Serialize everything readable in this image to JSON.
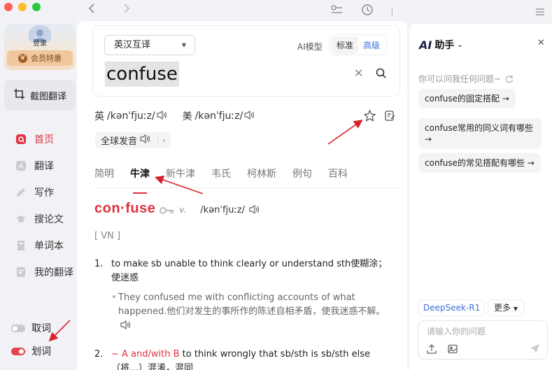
{
  "sidebar": {
    "login_label": "登录",
    "vip_label": "会员特惠",
    "screenshot_label": "截图翻译",
    "nav": [
      {
        "label": "首页",
        "icon": "home-icon",
        "active": true
      },
      {
        "label": "翻译",
        "icon": "translate-icon",
        "active": false
      },
      {
        "label": "写作",
        "icon": "pen-icon",
        "active": false
      },
      {
        "label": "搜论文",
        "icon": "mortarboard-icon",
        "active": false
      },
      {
        "label": "单词本",
        "icon": "notebook-icon",
        "active": false
      },
      {
        "label": "我的翻译",
        "icon": "document-icon",
        "active": false
      }
    ],
    "toggles": [
      {
        "label": "取词",
        "on": false
      },
      {
        "label": "划词",
        "on": true
      }
    ]
  },
  "search": {
    "mode": "英汉互译",
    "ai_model_label": "AI模型",
    "segments": [
      "标准",
      "高级"
    ],
    "query": "confuse"
  },
  "pron": {
    "uk_label": "英",
    "uk_ipa": "/kənˈfjuːz/",
    "us_label": "美",
    "us_ipa": "/kənˈfjuːz/",
    "global_label": "全球发音"
  },
  "tabs": [
    "简明",
    "牛津",
    "新牛津",
    "韦氏",
    "柯林斯",
    "例句",
    "百科"
  ],
  "entry": {
    "headword": "con·fuse",
    "pos": "v.",
    "ipa": "/kənˈfjuːz/",
    "grammar": "[ VN ]",
    "def1_num": "1.",
    "def1_text": "to make sb unable to think clearly or understand sth使糊涂；使迷惑",
    "ex1_text": "They confused me with conflicting accounts of what happened.他们对发生的事所作的陈述自相矛盾，使我迷惑不解。",
    "def2_num": "2.",
    "def2_phrase": "~ A and/with B",
    "def2_text": " to think wrongly that sb/sth is sb/sth else",
    "def2_cn": "（将…）混淆，混同"
  },
  "assistant": {
    "title": "助手",
    "ai_logo": "AI",
    "ask_hint": "你可以问我任何问题~",
    "suggestions": [
      "confuse的固定搭配",
      "confuse常用的同义词有哪些",
      "confuse的常见搭配有哪些"
    ],
    "model": "DeepSeek-R1",
    "more": "更多",
    "input_placeholder": "请输入你的问题"
  },
  "colors": {
    "accent_red": "#e0323f",
    "accent_blue": "#3d6fd8",
    "vip_gold": "#f1c79d"
  }
}
